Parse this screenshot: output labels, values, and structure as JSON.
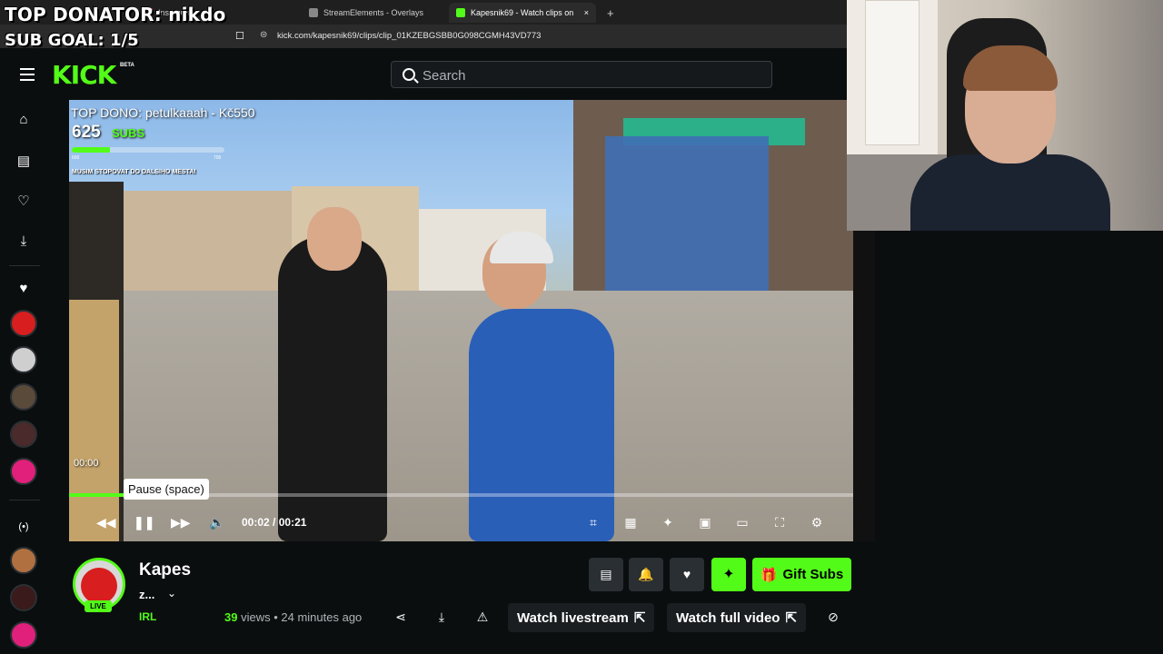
{
  "browser": {
    "tabs": [
      {
        "label": "Instagram"
      },
      {
        "label": "StreamElements - Overlays"
      },
      {
        "label": "Kapesnik69 - Watch clips on"
      }
    ],
    "url": "kick.com/kapesnik69/clips/clip_01KZEBGSBB0G098CGMH43VD773",
    "new_tab": "+",
    "close_tab": "×"
  },
  "stream_overlay": {
    "top_donator": "TOP DONATOR: nikdo",
    "sub_goal": "SUB GOAL: 1/5"
  },
  "header": {
    "logo": "KICK",
    "beta": "BETA",
    "search_placeholder": "Search"
  },
  "video": {
    "top_dono": "TOP DONO: petulkaaah - Kč550",
    "subs_count": "625",
    "subs_label": "SUBS",
    "goal_min": "600",
    "goal_max": "700",
    "goal_fraction": 0.25,
    "stream_note": "MUSIM STOPOVAT DO DALSIHO MESTA!",
    "time_overlay": "00:00",
    "tooltip": "Pause (space)",
    "current_time": "00:02",
    "separator": "/",
    "duration": "00:21",
    "progress_fraction": 0.095
  },
  "channel": {
    "name": "Kapes",
    "sub": "z...",
    "live": "LIVE",
    "category": "IRL",
    "views_count": "39",
    "views_label": "views",
    "time_ago": "• 24 minutes ago"
  },
  "actions": {
    "gift_subs": "Gift Subs",
    "watch_livestream": "Watch livestream",
    "watch_full_video": "Watch full video"
  },
  "colors": {
    "accent": "#53fc18",
    "background": "#0b0e0f"
  }
}
